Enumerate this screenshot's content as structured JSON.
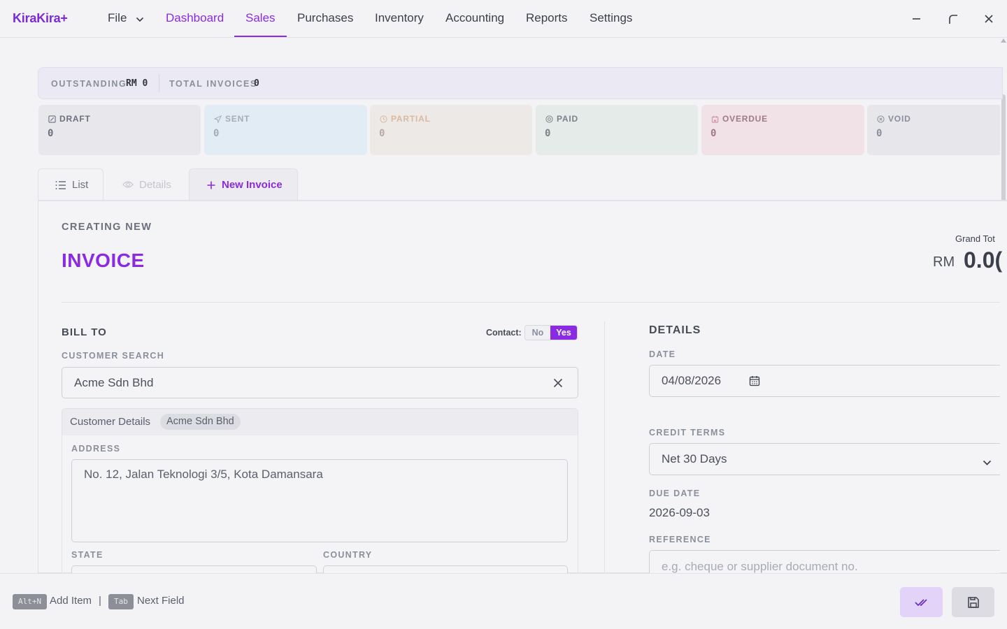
{
  "app": {
    "logo": "KiraKira+",
    "menu": {
      "file": "File",
      "dashboard": "Dashboard",
      "sales": "Sales",
      "purchases": "Purchases",
      "inventory": "Inventory",
      "accounting": "Accounting",
      "reports": "Reports",
      "settings": "Settings"
    },
    "active_menu": "Sales"
  },
  "summary": {
    "outstanding_label": "OUTSTANDING",
    "outstanding_value": "RM 0",
    "total_label": "TOTAL INVOICES",
    "total_value": "0"
  },
  "status_cards": [
    {
      "label": "DRAFT",
      "value": "0",
      "icon": "draft-icon",
      "color": "#6b707c",
      "bg": "#e7e7ec"
    },
    {
      "label": "SENT",
      "value": "0",
      "icon": "send-icon",
      "color": "#a5abb8",
      "bg": "#e2ecf5"
    },
    {
      "label": "PARTIAL",
      "value": "0",
      "icon": "clock-icon",
      "color": "#d9b9a0",
      "bg": "#ede9e7"
    },
    {
      "label": "PAID",
      "value": "0",
      "icon": "paid-icon",
      "color": "#7c818c",
      "bg": "#e5ebe8"
    },
    {
      "label": "OVERDUE",
      "value": "0",
      "icon": "calendar-alert-icon",
      "color": "#a07a85",
      "bg": "#f1e2e7"
    },
    {
      "label": "VOID",
      "value": "0",
      "icon": "void-icon",
      "color": "#8a8f9c",
      "bg": "#e6e6eb"
    }
  ],
  "tabs": {
    "list": "List",
    "details": "Details",
    "new_invoice": "New Invoice"
  },
  "form": {
    "mode": "CREATING NEW",
    "doc_type": "INVOICE",
    "grand_total_label": "Grand Tot",
    "grand_total_currency": "RM",
    "grand_total_value": "0.0(",
    "bill_to": "BILL TO",
    "contact_label": "Contact:",
    "contact_no": "No",
    "contact_yes": "Yes",
    "customer_search_label": "CUSTOMER SEARCH",
    "customer_search_value": "Acme Sdn Bhd",
    "customer_details_label": "Customer Details",
    "customer_chip": "Acme Sdn Bhd",
    "address_label": "ADDRESS",
    "address_value": "No. 12, Jalan Teknologi 3/5, Kota Damansara",
    "state_label": "STATE",
    "country_label": "COUNTRY",
    "details_title": "DETAILS",
    "date_label": "DATE",
    "date_value": "04/08/2026",
    "credit_terms_label": "CREDIT TERMS",
    "credit_terms_value": "Net 30 Days",
    "due_date_label": "DUE DATE",
    "due_date_value": "2026-09-03",
    "reference_label": "REFERENCE",
    "reference_placeholder": "e.g. cheque or supplier document no."
  },
  "footer": {
    "shortcut1_key": "Alt+N",
    "shortcut1_label": "Add Item",
    "separator": "|",
    "shortcut2_key": "Tab",
    "shortcut2_label": "Next Field"
  },
  "colors": {
    "accent": "#8a2be2",
    "approve_bg": "#e3d3f8"
  }
}
